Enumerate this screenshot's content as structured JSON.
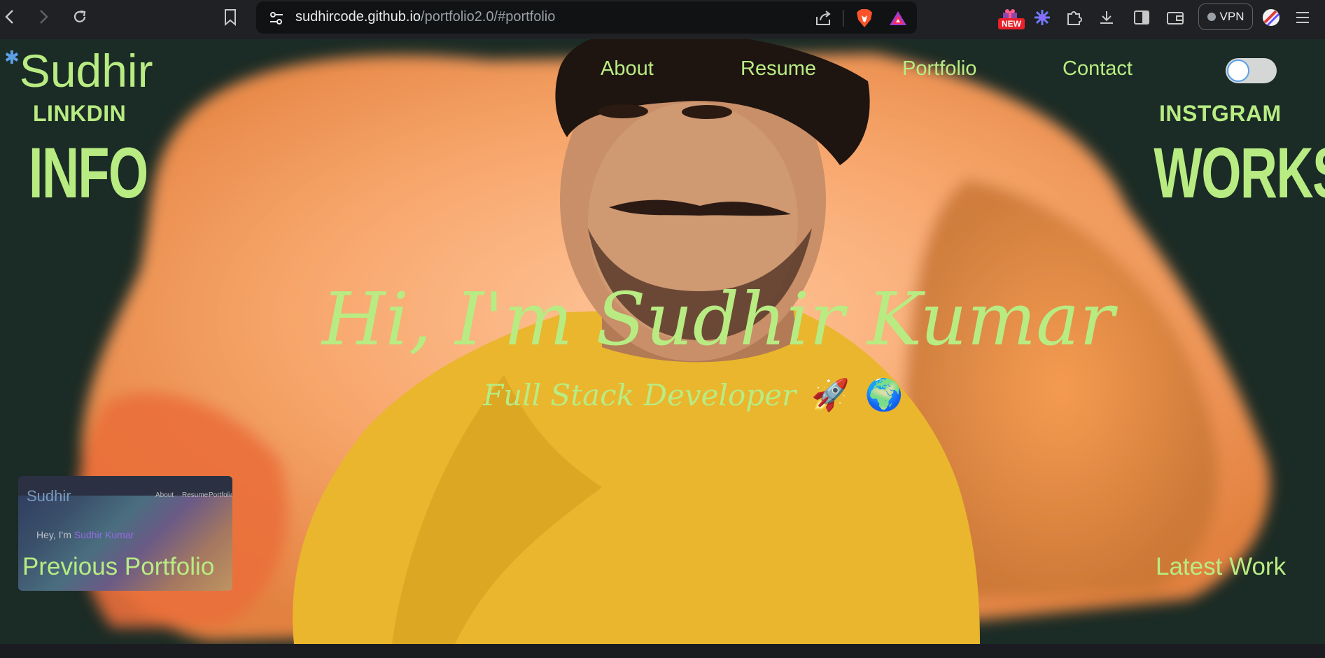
{
  "browser": {
    "url_host": "sudhircode.github.io",
    "url_path": "/portfolio2.0/#portfolio",
    "new_badge": "NEW",
    "vpn_label": "VPN",
    "icons": [
      "back-icon",
      "forward-icon",
      "reload-icon",
      "bookmark-icon",
      "site-settings-icon",
      "share-icon",
      "brave-shields-icon",
      "brave-rewards-icon",
      "leo-icon",
      "extensions-icon",
      "download-icon",
      "sidebar-icon",
      "wallet-icon",
      "profile-icon",
      "menu-icon"
    ]
  },
  "site": {
    "logo": "Sudhir",
    "nav": [
      "About",
      "Resume",
      "Portfolio",
      "Contact"
    ],
    "left_small": "LINKDIN",
    "left_big": "INFO",
    "right_small": "INSTGRAM",
    "right_big": "WORKS",
    "hero_title": "Hi, I'm Sudhir Kumar",
    "hero_subtitle": "Full Stack Developer",
    "emoji_rocket": "🚀",
    "emoji_globe": "🌍",
    "previous_portfolio": "Previous Portfolio",
    "latest_work": "Latest Work",
    "preview": {
      "logo": "Sudhir",
      "text_prefix": "Hey, I'm",
      "text_name": "Sudhir Kumar"
    },
    "colors": {
      "accent": "#b8ec83",
      "background": "#1b2b25",
      "splash": "#f4a261",
      "shirt": "#e9b62e"
    }
  }
}
